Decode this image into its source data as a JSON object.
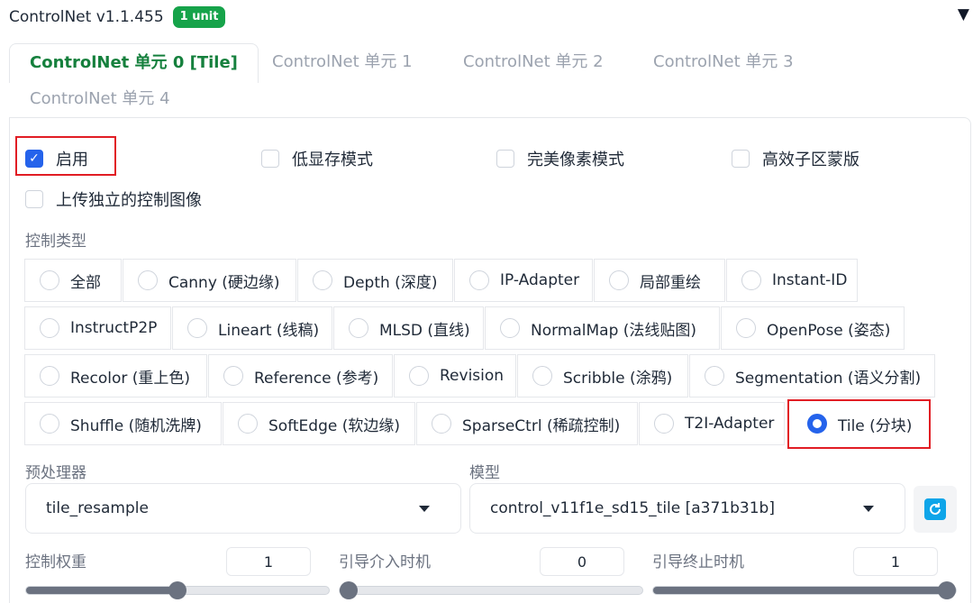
{
  "header": {
    "title": "ControlNet v1.1.455",
    "badge": "1 unit",
    "collapse_glyph": "▼"
  },
  "tabs": [
    {
      "label": "ControlNet 单元 0 [Tile]",
      "active": true
    },
    {
      "label": "ControlNet 单元 1",
      "active": false
    },
    {
      "label": "ControlNet 单元 2",
      "active": false
    },
    {
      "label": "ControlNet 单元 3",
      "active": false
    },
    {
      "label": "ControlNet 单元 4",
      "active": false
    }
  ],
  "options": {
    "enable": {
      "label": "启用",
      "checked": true
    },
    "low_vram": {
      "label": "低显存模式",
      "checked": false
    },
    "pixel_perfect": {
      "label": "完美像素模式",
      "checked": false
    },
    "efficient_mask": {
      "label": "高效子区蒙版",
      "checked": false
    },
    "upload_separate": {
      "label": "上传独立的控制图像",
      "checked": false
    }
  },
  "control_type": {
    "label": "控制类型",
    "items": [
      "全部",
      "Canny (硬边缘)",
      "Depth (深度)",
      "IP-Adapter",
      "局部重绘",
      "Instant-ID",
      "InstructP2P",
      "Lineart (线稿)",
      "MLSD (直线)",
      "NormalMap (法线贴图)",
      "OpenPose (姿态)",
      "Recolor (重上色)",
      "Reference (参考)",
      "Revision",
      "Scribble (涂鸦)",
      "Segmentation (语义分割)",
      "Shuffle (随机洗牌)",
      "SoftEdge (软边缘)",
      "SparseCtrl (稀疏控制)",
      "T2I-Adapter",
      "Tile (分块)"
    ],
    "selected": "Tile (分块)"
  },
  "preprocessor": {
    "label": "预处理器",
    "value": "tile_resample"
  },
  "model": {
    "label": "模型",
    "value": "control_v11f1e_sd15_tile [a371b31b]"
  },
  "sliders": {
    "weight": {
      "label": "控制权重",
      "value": "1",
      "fraction": 0.5
    },
    "start": {
      "label": "引导介入时机",
      "value": "0",
      "fraction": 0.0
    },
    "end": {
      "label": "引导终止时机",
      "value": "1",
      "fraction": 1.0
    }
  },
  "colors": {
    "accent": "#2563eb",
    "badge": "#16a34a",
    "highlight": "#e11d24"
  }
}
